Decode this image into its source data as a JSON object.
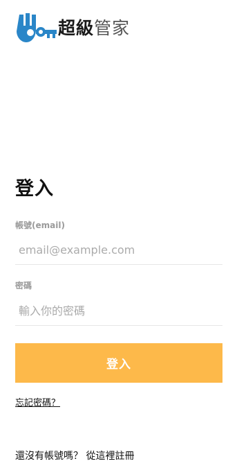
{
  "brand": {
    "logo_icon": "key-hand-logo-icon",
    "name_bold": "超級",
    "name_light": "管家",
    "accent_color": "#2a86c8"
  },
  "login": {
    "title": "登入",
    "email": {
      "label": "帳號(email)",
      "placeholder": "email@example.com",
      "value": ""
    },
    "password": {
      "label": "密碼",
      "placeholder": "輸入你的密碼",
      "value": ""
    },
    "submit_label": "登入",
    "submit_color": "#fdb94a",
    "forgot_label": "忘記密碼？"
  },
  "signup": {
    "prompt": "還沒有帳號嗎？",
    "link_label": "從這裡註冊"
  }
}
